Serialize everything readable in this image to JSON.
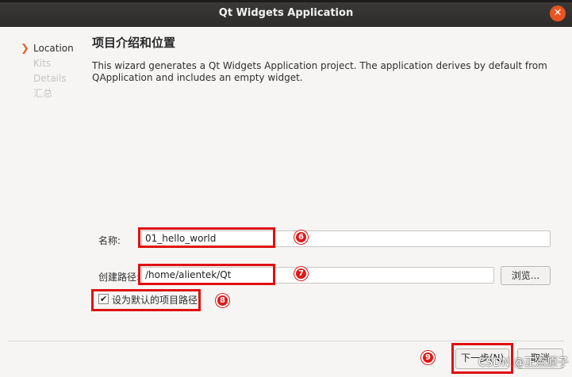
{
  "window": {
    "title": "Qt Widgets Application",
    "close_glyph": "✕"
  },
  "sidebar": {
    "items": [
      {
        "label": "Location",
        "active": true,
        "marker": "❯"
      },
      {
        "label": "Kits",
        "active": false
      },
      {
        "label": "Details",
        "active": false
      },
      {
        "label": "汇总",
        "active": false
      }
    ]
  },
  "main": {
    "title": "项目介绍和位置",
    "description": "This wizard generates a Qt Widgets Application project. The application derives by default from QApplication and includes an empty widget."
  },
  "form": {
    "name_label": "名称:",
    "name_value": "01_hello_world",
    "path_label": "创建路径:",
    "path_value": "/home/alientek/Qt",
    "browse_label": "浏览...",
    "default_path_label": "设为默认的项目路径",
    "default_path_checked": true,
    "check_glyph": "✔"
  },
  "footer": {
    "next_label": "下一步(N)",
    "cancel_label": "取消"
  },
  "annotations": {
    "badge_name": "6",
    "badge_path": "7",
    "badge_checkbox": "8",
    "badge_next": "9",
    "accent_color": "#e01010"
  },
  "watermark": "CSDN @正点原子"
}
